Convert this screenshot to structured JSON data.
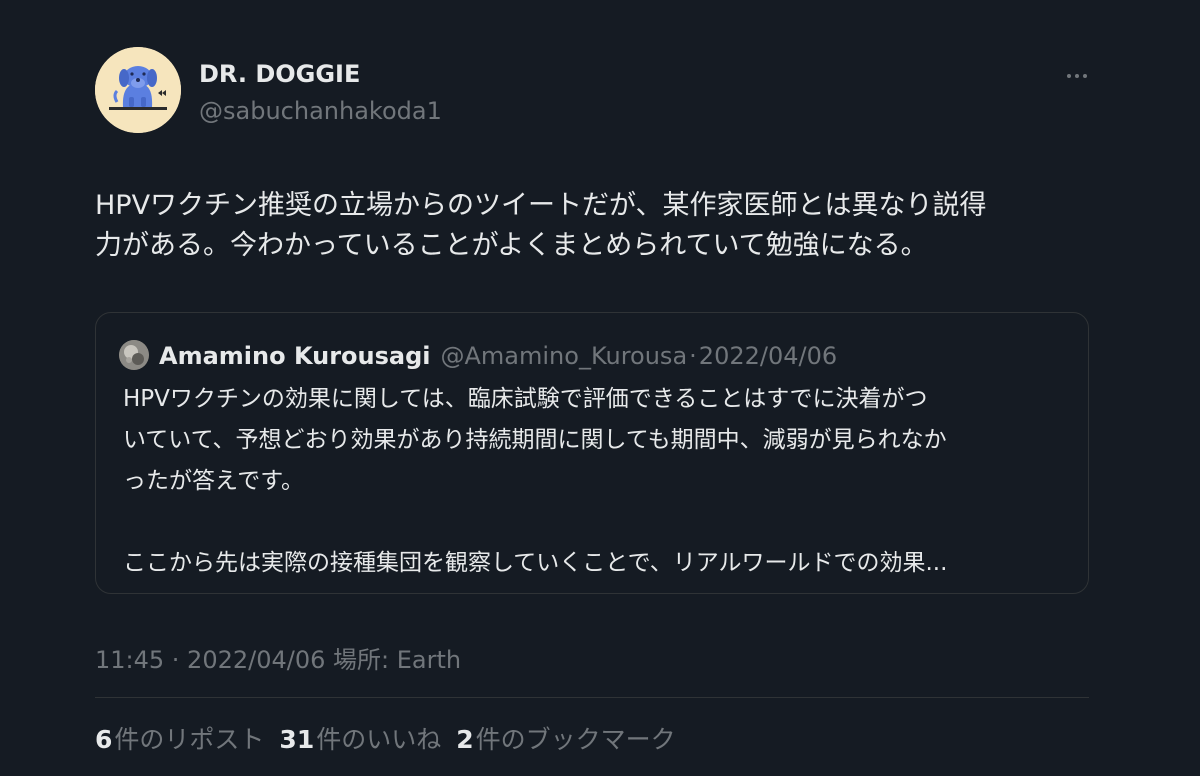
{
  "author": {
    "display_name": "DR. DOGGIE",
    "handle": "@sabuchanhakoda1",
    "avatar_icon": "dog-avatar-icon"
  },
  "tweet": {
    "text": "HPVワクチン推奨の立場からのツイートだが、某作家医師とは異なり説得\n力がある。今わかっていることがよくまとめられていて勉強になる。"
  },
  "quoted_tweet": {
    "display_name": "Amamino Kurousagi",
    "handle": "@Amamino_Kurousa",
    "separator": "·",
    "date": "2022/04/06",
    "text": "HPVワクチンの効果に関しては、臨床試験で評価できることはすでに決着がつ\nいていて、予想どおり効果があり持続期間に関しても期間中、減弱が見られなか\nったが答えです。\n\nここから先は実際の接種集団を観察していくことで、リアルワールドでの効果..."
  },
  "meta": {
    "timestamp": "11:45 · 2022/04/06 場所: Earth"
  },
  "stats": {
    "reposts_count": "6",
    "reposts_label": "件のリポスト",
    "likes_count": "31",
    "likes_label": "件のいいね",
    "bookmarks_count": "2",
    "bookmarks_label": "件のブックマーク"
  },
  "colors": {
    "background": "#151b23",
    "text_primary": "#e7e9ea",
    "text_secondary": "#71767b",
    "border": "#2f3336",
    "avatar_bg": "#f6e5bd",
    "avatar_dog": "#5b7fe0"
  }
}
